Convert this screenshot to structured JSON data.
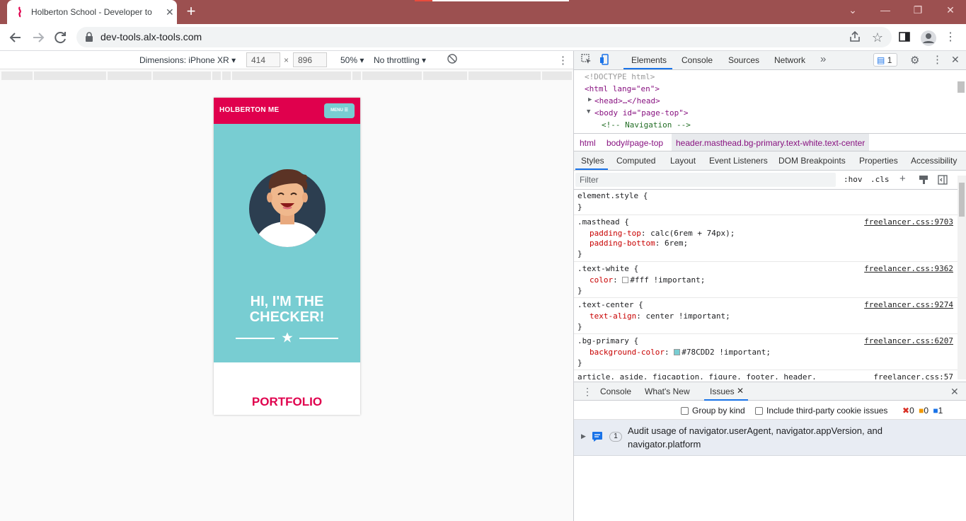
{
  "browser": {
    "tab_title": "Holberton School - Developer to",
    "new_tab_label": "+",
    "url": "dev-tools.alx-tools.com"
  },
  "device_toolbar": {
    "dimensions_label": "Dimensions: iPhone XR",
    "width": "414",
    "times": "×",
    "height": "896",
    "zoom": "50%",
    "throttling": "No throttling"
  },
  "phone": {
    "brand": "HOLBERTON ME",
    "menu": "MENU ☰",
    "heading_line1": "HI, I'M THE",
    "heading_line2": "CHECKER!",
    "section_title": "PORTFOLIO",
    "colors": {
      "primary": "#78CDD2",
      "accent": "#E0004D"
    }
  },
  "devtools": {
    "tabs": [
      "Elements",
      "Console",
      "Sources",
      "Network"
    ],
    "issues_badge": "1",
    "dom": {
      "doctype": "<!DOCTYPE html>",
      "html_open": "<html lang=\"en\">",
      "head": "<head>…</head>",
      "body_open": "<body id=\"page-top\">",
      "comment": "<!-- Navigation -->"
    },
    "breadcrumbs": [
      "html",
      "body#page-top",
      "header.masthead.bg-primary.text-white.text-center"
    ],
    "subtabs": [
      "Styles",
      "Computed",
      "Layout",
      "Event Listeners",
      "DOM Breakpoints",
      "Properties",
      "Accessibility"
    ],
    "filter_placeholder": "Filter",
    "hov": ":hov",
    "cls": ".cls",
    "rules": {
      "element_style": "element.style {",
      "close_brace": "}",
      "masthead": {
        "selector": ".masthead {",
        "source": "freelancer.css:9703",
        "p1": "padding-top",
        "v1": ": calc(6rem + 74px);",
        "p2": "padding-bottom",
        "v2": ": 6rem;"
      },
      "text_white": {
        "selector": ".text-white {",
        "source": "freelancer.css:9362",
        "p1": "color",
        "v1": "#fff !important;"
      },
      "text_center": {
        "selector": ".text-center {",
        "source": "freelancer.css:9274",
        "p1": "text-align",
        "v1": ": center !important;"
      },
      "bg_primary": {
        "selector": ".bg-primary {",
        "source": "freelancer.css:6207",
        "p1": "background-color",
        "v1": "#78CDD2 !important;"
      },
      "article": {
        "selector": "article, aside, figcaption, figure, footer, header,",
        "source": "freelancer.css:57"
      }
    },
    "drawer_tabs": [
      "Console",
      "What's New",
      "Issues"
    ],
    "group_by_kind": "Group by kind",
    "include_third_party": "Include third-party cookie issues",
    "counts": {
      "errors": "0",
      "warnings": "0",
      "info": "1"
    },
    "issue": {
      "count": "1",
      "text_line1": "Audit usage of navigator.userAgent, navigator.appVersion, and",
      "text_line2": "navigator.platform"
    }
  }
}
